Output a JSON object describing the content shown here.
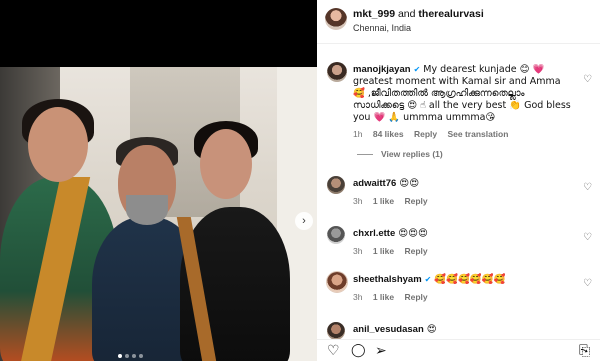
{
  "post": {
    "author": "mkt_999",
    "and_text": "and",
    "coauthor": "therealurvasi",
    "location": "Chennai, India"
  },
  "media": {
    "next_icon": "chevron-right-icon",
    "next_glyph": "›",
    "dots_count": 4,
    "active_dot": 0
  },
  "comments": [
    {
      "username": "manojkjayan",
      "verified": true,
      "text": "My dearest kunjade 😊 💗 greatest moment with Kamal sir and Amma 🥰 ,ജീവിതത്തിൽ ആഗ്രഹിക്കുന്നതെല്ലാം സാധിക്കട്ടെ 😍 ☝ all the very best 👏 God bless you 💗 🙏 ummma ummma😘",
      "time": "1h",
      "likes": "84 likes",
      "reply": "Reply",
      "extra": "See translation",
      "view_replies": "View replies (1)"
    },
    {
      "username": "adwaitt76",
      "verified": false,
      "text": "😍😍",
      "time": "3h",
      "likes": "1 like",
      "reply": "Reply"
    },
    {
      "username": "chxrl.ette",
      "verified": false,
      "text": "😍😍😍",
      "time": "3h",
      "likes": "1 like",
      "reply": "Reply"
    },
    {
      "username": "sheethalshyam",
      "verified": true,
      "text": "🥰🥰🥰🥰🥰🥰",
      "time": "3h",
      "likes": "1 like",
      "reply": "Reply"
    },
    {
      "username": "anil_vesudasan",
      "verified": false,
      "text": "😍",
      "time": "",
      "likes": "",
      "reply": ""
    }
  ],
  "icons": {
    "heart": "♡",
    "like": "♡",
    "comment": "◯",
    "share": "➢",
    "save": "⎘",
    "verified": "✔"
  },
  "colors": {
    "verified": "#0095f6",
    "meta": "#737373"
  }
}
